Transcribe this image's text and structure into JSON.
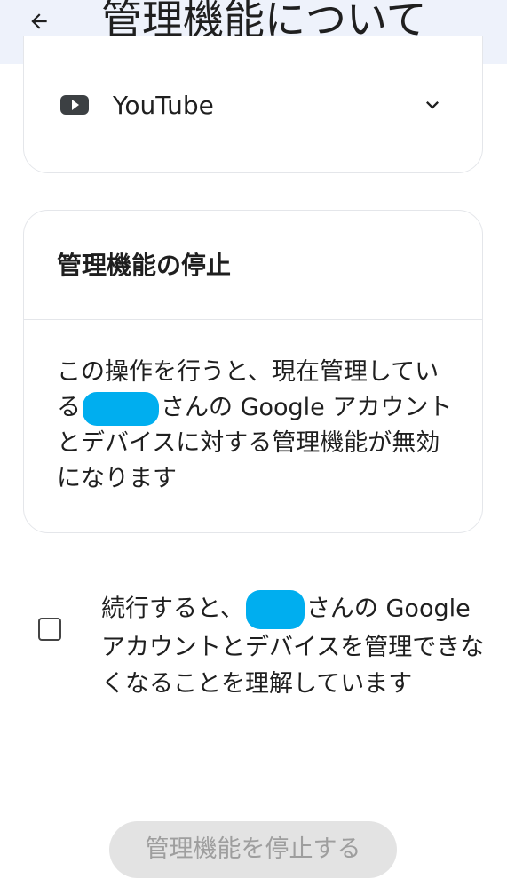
{
  "appbar": {
    "title": "管理機能について"
  },
  "section_top": {
    "item_label": "YouTube"
  },
  "stop_card": {
    "title": "管理機能の停止",
    "body_part1": "この操作を行うと、現在管理している",
    "body_part2": "さんの Google アカウントとデバイスに対する管理機能が無効になります"
  },
  "consent": {
    "part1": "続行すると、",
    "part2": "さんの Google アカウントとデバイスを管理できなくなることを理解しています"
  },
  "stop_button": {
    "label": "管理機能を停止する"
  },
  "colors": {
    "appbar_bg": "#eef2fb",
    "redaction": "#00aeef",
    "disabled_button_bg": "#e3e3e3"
  }
}
